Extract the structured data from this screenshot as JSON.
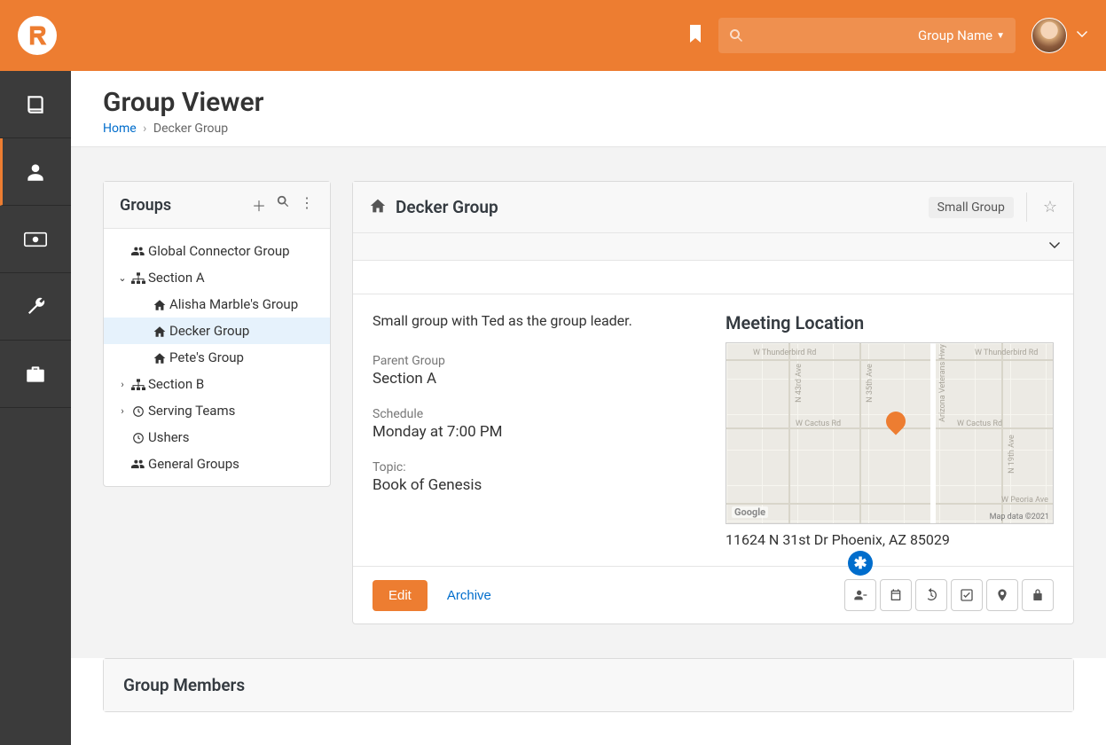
{
  "header": {
    "search_label": "Group Name"
  },
  "page": {
    "title": "Group Viewer",
    "breadcrumb_home": "Home",
    "breadcrumb_current": "Decker Group"
  },
  "groups_panel": {
    "title": "Groups",
    "items": [
      {
        "label": "Global Connector Group",
        "icon": "users",
        "chevron": "none",
        "indent": 0
      },
      {
        "label": "Section A",
        "icon": "sitemap",
        "chevron": "down",
        "indent": 0
      },
      {
        "label": "Alisha Marble's Group",
        "icon": "home",
        "chevron": "none",
        "indent": 1
      },
      {
        "label": "Decker Group",
        "icon": "home",
        "chevron": "none",
        "indent": 1,
        "selected": true
      },
      {
        "label": "Pete's Group",
        "icon": "home",
        "chevron": "none",
        "indent": 1
      },
      {
        "label": "Section B",
        "icon": "sitemap",
        "chevron": "right",
        "indent": 0
      },
      {
        "label": "Serving Teams",
        "icon": "clock",
        "chevron": "right",
        "indent": 0
      },
      {
        "label": "Ushers",
        "icon": "clock",
        "chevron": "none",
        "indent": 0
      },
      {
        "label": "General Groups",
        "icon": "users",
        "chevron": "none",
        "indent": 0
      }
    ]
  },
  "detail": {
    "title": "Decker Group",
    "type_badge": "Small Group",
    "description": "Small group with Ted as the group leader.",
    "parent_label": "Parent Group",
    "parent_value": "Section A",
    "schedule_label": "Schedule",
    "schedule_value": "Monday at 7:00 PM",
    "topic_label": "Topic:",
    "topic_value": "Book of Genesis",
    "location_title": "Meeting Location",
    "address": "11624 N 31st Dr Phoenix, AZ 85029",
    "map_google": "Google",
    "map_attribution": "Map data ©2021",
    "map_labels": {
      "thunderbird_w": "W Thunderbird Rd",
      "thunderbird_e": "W Thunderbird Rd",
      "cactus_w": "W Cactus Rd",
      "cactus_e": "W Cactus Rd",
      "peoria": "W Peoria Ave",
      "n43": "N 43rd Ave",
      "n35": "N 35th Ave",
      "n19": "N 19th Ave",
      "veterans": "Arizona Veterans Hwy"
    },
    "edit_label": "Edit",
    "archive_label": "Archive",
    "badge_symbol": "✱"
  },
  "members": {
    "title": "Group Members"
  }
}
